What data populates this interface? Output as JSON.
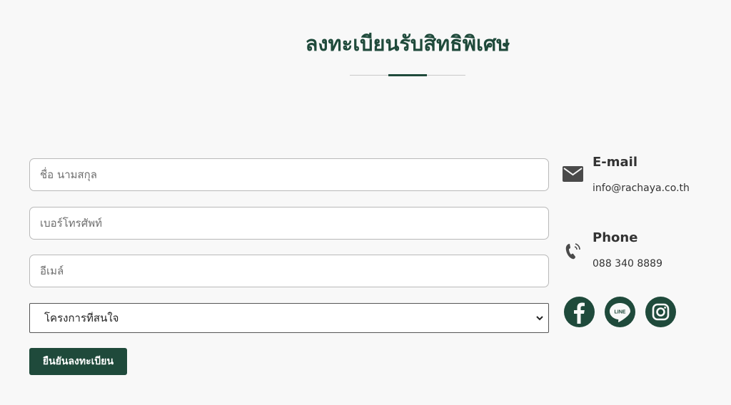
{
  "header": {
    "title": "ลงทะเบียนรับสิทธิพิเศษ"
  },
  "form": {
    "name_placeholder": "ชื่อ นามสกุล",
    "phone_placeholder": "เบอร์โทรศัพท์",
    "email_placeholder": "อีเมล์",
    "project_select": {
      "selected": "โครงการที่สนใจ"
    },
    "submit_label": "ยืนยันลงทะเบียน"
  },
  "contact": {
    "email_label": "E-mail",
    "email_value": "info@rachaya.co.th",
    "phone_label": "Phone",
    "phone_value": "088 340 8889"
  },
  "social": {
    "icons": [
      "facebook-icon",
      "line-icon",
      "instagram-icon"
    ]
  },
  "colors": {
    "brand_green": "#1f4a3b",
    "background": "#f8f8f8",
    "icon_gray": "#4a4a4a"
  }
}
